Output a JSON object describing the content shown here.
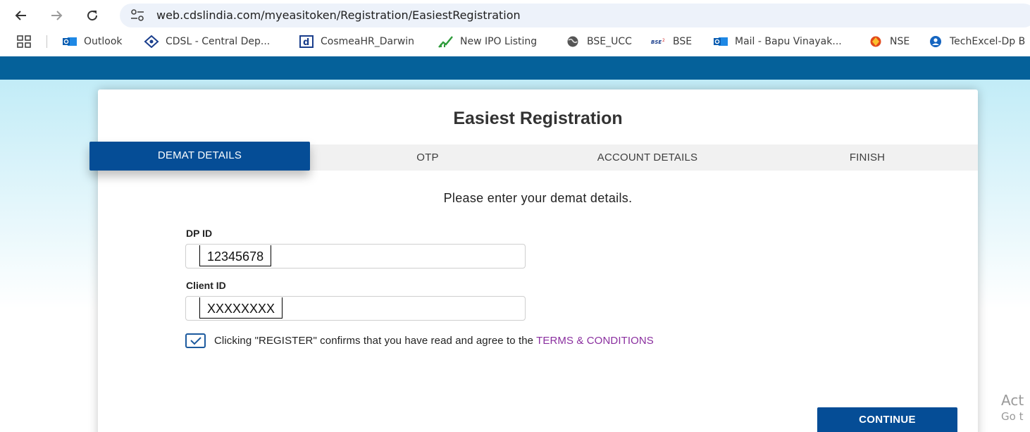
{
  "browser": {
    "url": "web.cdslindia.com/myeasitoken/Registration/EasiestRegistration",
    "bookmarks": [
      {
        "label": "Outlook",
        "icon": "outlook-icon"
      },
      {
        "label": "CDSL - Central Dep...",
        "icon": "cdsl-icon"
      },
      {
        "label": "CosmeaHR_Darwin",
        "icon": "darwin-icon"
      },
      {
        "label": "New IPO Listing",
        "icon": "ipo-chart-icon"
      },
      {
        "label": "BSE_UCC",
        "icon": "globe-icon"
      },
      {
        "label": "BSE",
        "icon": "bse-icon"
      },
      {
        "label": "Mail - Bapu Vinayak...",
        "icon": "outlook-icon"
      },
      {
        "label": "NSE",
        "icon": "nse-icon"
      },
      {
        "label": "TechExcel-Dp B",
        "icon": "techexcel-icon"
      }
    ]
  },
  "page": {
    "title": "Easiest Registration",
    "steps": [
      {
        "label": "DEMAT DETAILS",
        "active": true
      },
      {
        "label": "OTP",
        "active": false
      },
      {
        "label": "ACCOUNT DETAILS",
        "active": false
      },
      {
        "label": "FINISH",
        "active": false
      }
    ],
    "instruction": "Please enter your demat details.",
    "dp_id": {
      "label": "DP ID",
      "value": "12345678"
    },
    "client_id": {
      "label": "Client ID",
      "value": "XXXXXXXX"
    },
    "terms": {
      "checked": true,
      "text": "Clicking \"REGISTER\" confirms that you have read and agree to the",
      "link": "TERMS & CONDITIONS"
    },
    "continue_label": "CONTINUE"
  },
  "watermark": {
    "line1": "Act",
    "line2": "Go t"
  },
  "colors": {
    "header_bar": "#05619a",
    "primary_button": "#054d96",
    "link": "#8a2f9f",
    "steps_bar": "#f1f1f1"
  }
}
